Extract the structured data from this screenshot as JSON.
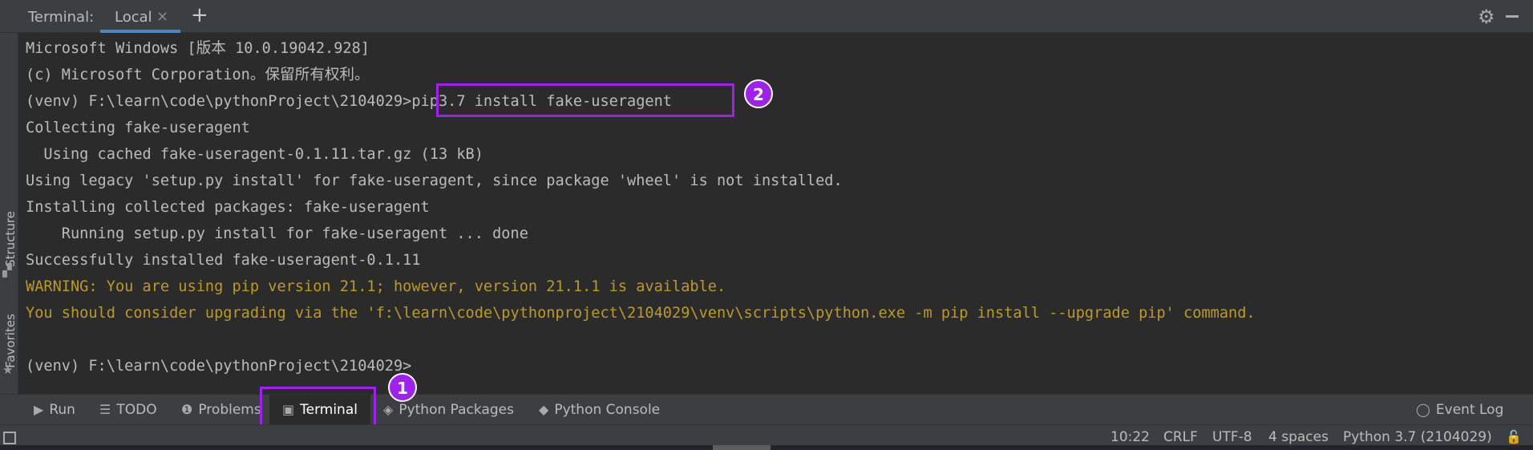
{
  "topbar": {
    "terminal_label": "Terminal:",
    "tab_local": "Local",
    "close_glyph": "×",
    "plus_glyph": "+",
    "gear_glyph": "⚙"
  },
  "left_stripe": {
    "structure": "Structure",
    "favorites": "Favorites"
  },
  "terminal": {
    "lines": [
      "Microsoft Windows [版本 10.0.19042.928]",
      "(c) Microsoft Corporation。保留所有权利。",
      "(venv) F:\\learn\\code\\pythonProject\\2104029>pip3.7 install fake-useragent",
      "Collecting fake-useragent",
      "  Using cached fake-useragent-0.1.11.tar.gz (13 kB)",
      "Using legacy 'setup.py install' for fake-useragent, since package 'wheel' is not installed.",
      "Installing collected packages: fake-useragent",
      "    Running setup.py install for fake-useragent ... done",
      "Successfully installed fake-useragent-0.1.11",
      "WARNING: You are using pip version 21.1; however, version 21.1.1 is available.",
      "You should consider upgrading via the 'f:\\learn\\code\\pythonproject\\2104029\\venv\\scripts\\python.exe -m pip install --upgrade pip' command.",
      "",
      "(venv) F:\\learn\\code\\pythonProject\\2104029>"
    ]
  },
  "annotations": {
    "badge_1": "1",
    "badge_2": "2",
    "highlight_color": "#a020f0"
  },
  "toolwindows": {
    "run": "Run",
    "todo": "TODO",
    "problems": "Problems",
    "terminal": "Terminal",
    "python_packages": "Python Packages",
    "python_console": "Python Console",
    "event_log": "Event Log"
  },
  "statusbar": {
    "position": "10:22",
    "line_sep": "CRLF",
    "encoding": "UTF-8",
    "indent": "4 spaces",
    "interpreter": "Python 3.7 (2104029)"
  },
  "colors": {
    "background": "#2b2b2b",
    "panel": "#3c3f41",
    "text": "#bbbbbb",
    "warning": "#bb9a26",
    "accent": "#4a88c7"
  }
}
